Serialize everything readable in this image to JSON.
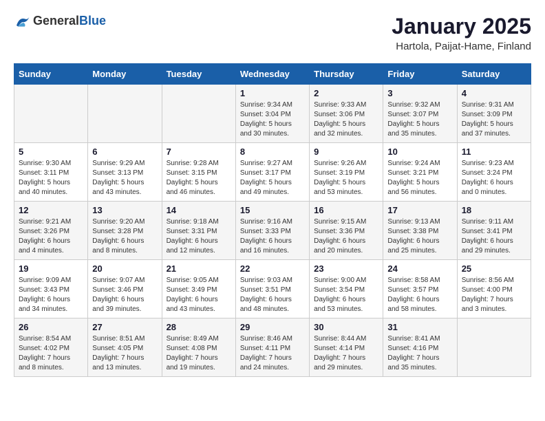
{
  "header": {
    "logo_general": "General",
    "logo_blue": "Blue",
    "title": "January 2025",
    "subtitle": "Hartola, Paijat-Hame, Finland"
  },
  "calendar": {
    "days_of_week": [
      "Sunday",
      "Monday",
      "Tuesday",
      "Wednesday",
      "Thursday",
      "Friday",
      "Saturday"
    ],
    "weeks": [
      [
        {
          "day": "",
          "info": ""
        },
        {
          "day": "",
          "info": ""
        },
        {
          "day": "",
          "info": ""
        },
        {
          "day": "1",
          "info": "Sunrise: 9:34 AM\nSunset: 3:04 PM\nDaylight: 5 hours\nand 30 minutes."
        },
        {
          "day": "2",
          "info": "Sunrise: 9:33 AM\nSunset: 3:06 PM\nDaylight: 5 hours\nand 32 minutes."
        },
        {
          "day": "3",
          "info": "Sunrise: 9:32 AM\nSunset: 3:07 PM\nDaylight: 5 hours\nand 35 minutes."
        },
        {
          "day": "4",
          "info": "Sunrise: 9:31 AM\nSunset: 3:09 PM\nDaylight: 5 hours\nand 37 minutes."
        }
      ],
      [
        {
          "day": "5",
          "info": "Sunrise: 9:30 AM\nSunset: 3:11 PM\nDaylight: 5 hours\nand 40 minutes."
        },
        {
          "day": "6",
          "info": "Sunrise: 9:29 AM\nSunset: 3:13 PM\nDaylight: 5 hours\nand 43 minutes."
        },
        {
          "day": "7",
          "info": "Sunrise: 9:28 AM\nSunset: 3:15 PM\nDaylight: 5 hours\nand 46 minutes."
        },
        {
          "day": "8",
          "info": "Sunrise: 9:27 AM\nSunset: 3:17 PM\nDaylight: 5 hours\nand 49 minutes."
        },
        {
          "day": "9",
          "info": "Sunrise: 9:26 AM\nSunset: 3:19 PM\nDaylight: 5 hours\nand 53 minutes."
        },
        {
          "day": "10",
          "info": "Sunrise: 9:24 AM\nSunset: 3:21 PM\nDaylight: 5 hours\nand 56 minutes."
        },
        {
          "day": "11",
          "info": "Sunrise: 9:23 AM\nSunset: 3:24 PM\nDaylight: 6 hours\nand 0 minutes."
        }
      ],
      [
        {
          "day": "12",
          "info": "Sunrise: 9:21 AM\nSunset: 3:26 PM\nDaylight: 6 hours\nand 4 minutes."
        },
        {
          "day": "13",
          "info": "Sunrise: 9:20 AM\nSunset: 3:28 PM\nDaylight: 6 hours\nand 8 minutes."
        },
        {
          "day": "14",
          "info": "Sunrise: 9:18 AM\nSunset: 3:31 PM\nDaylight: 6 hours\nand 12 minutes."
        },
        {
          "day": "15",
          "info": "Sunrise: 9:16 AM\nSunset: 3:33 PM\nDaylight: 6 hours\nand 16 minutes."
        },
        {
          "day": "16",
          "info": "Sunrise: 9:15 AM\nSunset: 3:36 PM\nDaylight: 6 hours\nand 20 minutes."
        },
        {
          "day": "17",
          "info": "Sunrise: 9:13 AM\nSunset: 3:38 PM\nDaylight: 6 hours\nand 25 minutes."
        },
        {
          "day": "18",
          "info": "Sunrise: 9:11 AM\nSunset: 3:41 PM\nDaylight: 6 hours\nand 29 minutes."
        }
      ],
      [
        {
          "day": "19",
          "info": "Sunrise: 9:09 AM\nSunset: 3:43 PM\nDaylight: 6 hours\nand 34 minutes."
        },
        {
          "day": "20",
          "info": "Sunrise: 9:07 AM\nSunset: 3:46 PM\nDaylight: 6 hours\nand 39 minutes."
        },
        {
          "day": "21",
          "info": "Sunrise: 9:05 AM\nSunset: 3:49 PM\nDaylight: 6 hours\nand 43 minutes."
        },
        {
          "day": "22",
          "info": "Sunrise: 9:03 AM\nSunset: 3:51 PM\nDaylight: 6 hours\nand 48 minutes."
        },
        {
          "day": "23",
          "info": "Sunrise: 9:00 AM\nSunset: 3:54 PM\nDaylight: 6 hours\nand 53 minutes."
        },
        {
          "day": "24",
          "info": "Sunrise: 8:58 AM\nSunset: 3:57 PM\nDaylight: 6 hours\nand 58 minutes."
        },
        {
          "day": "25",
          "info": "Sunrise: 8:56 AM\nSunset: 4:00 PM\nDaylight: 7 hours\nand 3 minutes."
        }
      ],
      [
        {
          "day": "26",
          "info": "Sunrise: 8:54 AM\nSunset: 4:02 PM\nDaylight: 7 hours\nand 8 minutes."
        },
        {
          "day": "27",
          "info": "Sunrise: 8:51 AM\nSunset: 4:05 PM\nDaylight: 7 hours\nand 13 minutes."
        },
        {
          "day": "28",
          "info": "Sunrise: 8:49 AM\nSunset: 4:08 PM\nDaylight: 7 hours\nand 19 minutes."
        },
        {
          "day": "29",
          "info": "Sunrise: 8:46 AM\nSunset: 4:11 PM\nDaylight: 7 hours\nand 24 minutes."
        },
        {
          "day": "30",
          "info": "Sunrise: 8:44 AM\nSunset: 4:14 PM\nDaylight: 7 hours\nand 29 minutes."
        },
        {
          "day": "31",
          "info": "Sunrise: 8:41 AM\nSunset: 4:16 PM\nDaylight: 7 hours\nand 35 minutes."
        },
        {
          "day": "",
          "info": ""
        }
      ]
    ]
  }
}
